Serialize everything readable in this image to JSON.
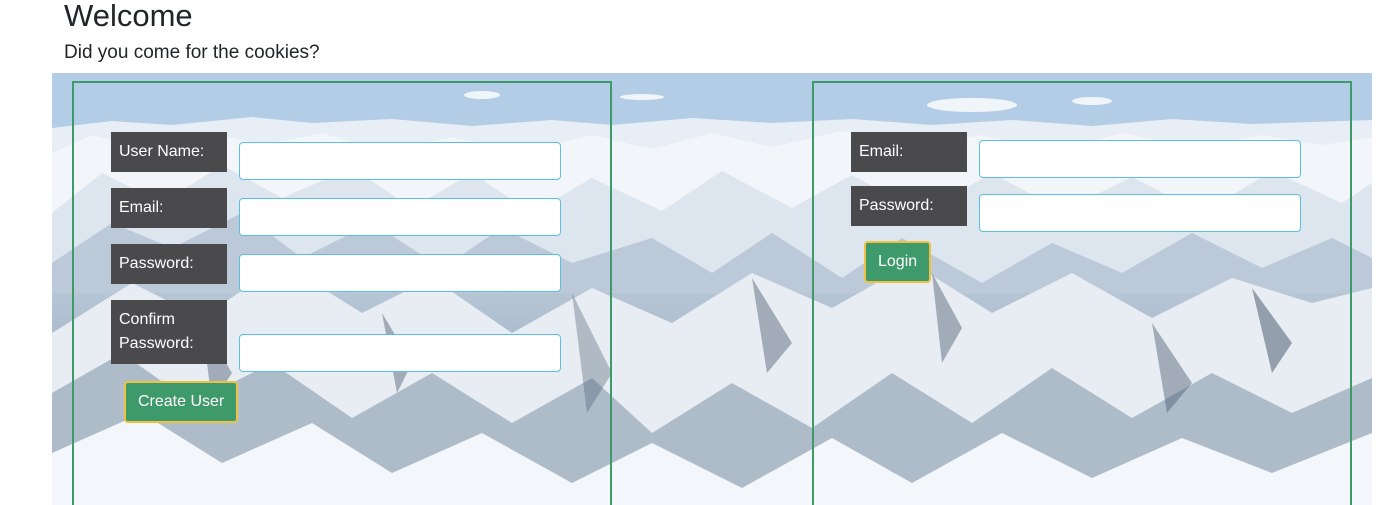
{
  "header": {
    "title": "Welcome",
    "subtitle": "Did you come for the cookies?"
  },
  "register": {
    "username_label": "User Name:",
    "email_label": "Email:",
    "password_label": "Password:",
    "confirm_label_line1": "Confirm",
    "confirm_label_line2": "Password:",
    "username_value": "",
    "email_value": "",
    "password_value": "",
    "confirm_value": "",
    "submit_label": "Create User"
  },
  "login": {
    "email_label": "Email:",
    "password_label": "Password:",
    "email_value": "",
    "password_value": "",
    "submit_label": "Login"
  },
  "colors": {
    "panel_border": "#3e9a6a",
    "button_bg": "#3e9a6a",
    "button_border": "#f0c040",
    "label_bg": "#4a4a4d",
    "input_border": "#5bc0de"
  },
  "background": {
    "icon": "snowy-mountains-image"
  }
}
